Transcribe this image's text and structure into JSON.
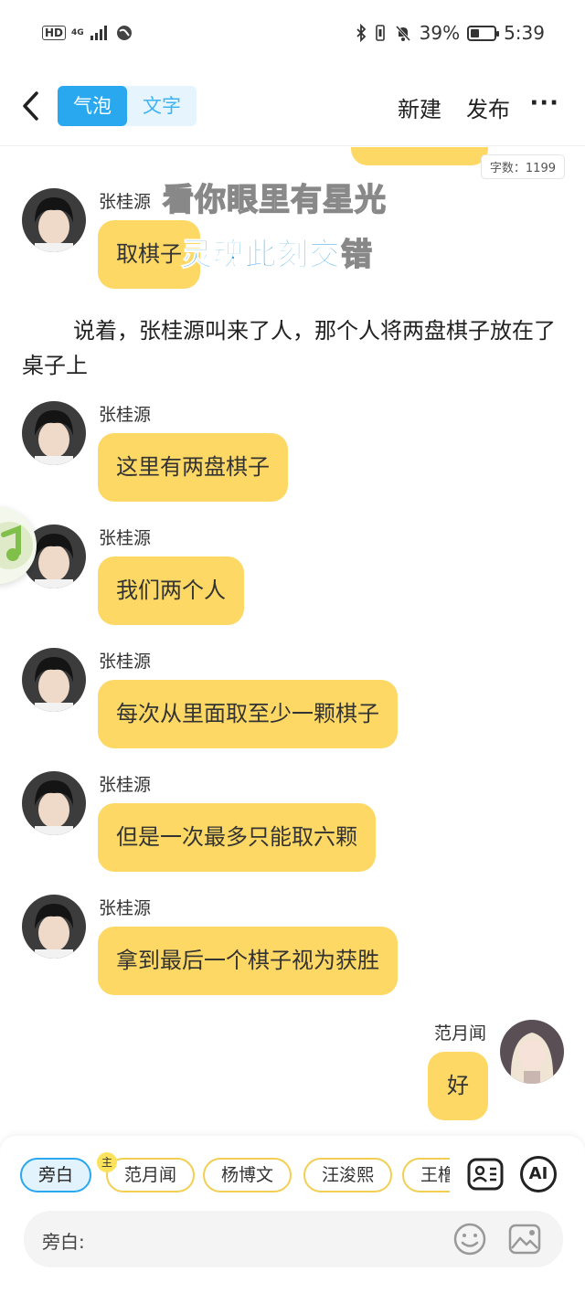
{
  "status_bar": {
    "hd": "HD",
    "network": "4G",
    "battery_percent": "39%",
    "battery_level": 0.39,
    "time": "5:39"
  },
  "top_bar": {
    "tabs": [
      {
        "label": "气泡",
        "active": true
      },
      {
        "label": "文字",
        "active": false
      }
    ],
    "new_label": "新建",
    "publish_label": "发布",
    "more_label": "···"
  },
  "word_count": "字数：1199",
  "lyrics": {
    "line1": "看你眼里有星光",
    "line2_highlight": "灵魂此刻交",
    "line2_rest": "错"
  },
  "messages": [
    {
      "sender": "张桂源",
      "text": "取棋子"
    },
    {
      "sender": "张桂源",
      "text": "这里有两盘棋子"
    },
    {
      "sender": "张桂源",
      "text": "我们两个人"
    },
    {
      "sender": "张桂源",
      "text": "每次从里面取至少一颗棋子"
    },
    {
      "sender": "张桂源",
      "text": "但是一次最多只能取六颗"
    },
    {
      "sender": "张桂源",
      "text": "拿到最后一个棋子视为获胜"
    }
  ],
  "narration": "说着，张桂源叫来了人，那个人将两盘棋子放在了桌子上",
  "reply": {
    "sender": "范月闻",
    "text": "好"
  },
  "roles": [
    {
      "label": "旁白",
      "active": true
    },
    {
      "label": "范月闻",
      "active": false,
      "owner": true
    },
    {
      "label": "杨博文",
      "active": false
    },
    {
      "label": "汪浚熙",
      "active": false
    },
    {
      "label": "王橹",
      "active": false
    }
  ],
  "owner_badge": "主",
  "ai_label": "AI",
  "input": {
    "label": "旁白:"
  },
  "colors": {
    "bubble": "#fdd864",
    "accent": "#2aa8ef"
  }
}
